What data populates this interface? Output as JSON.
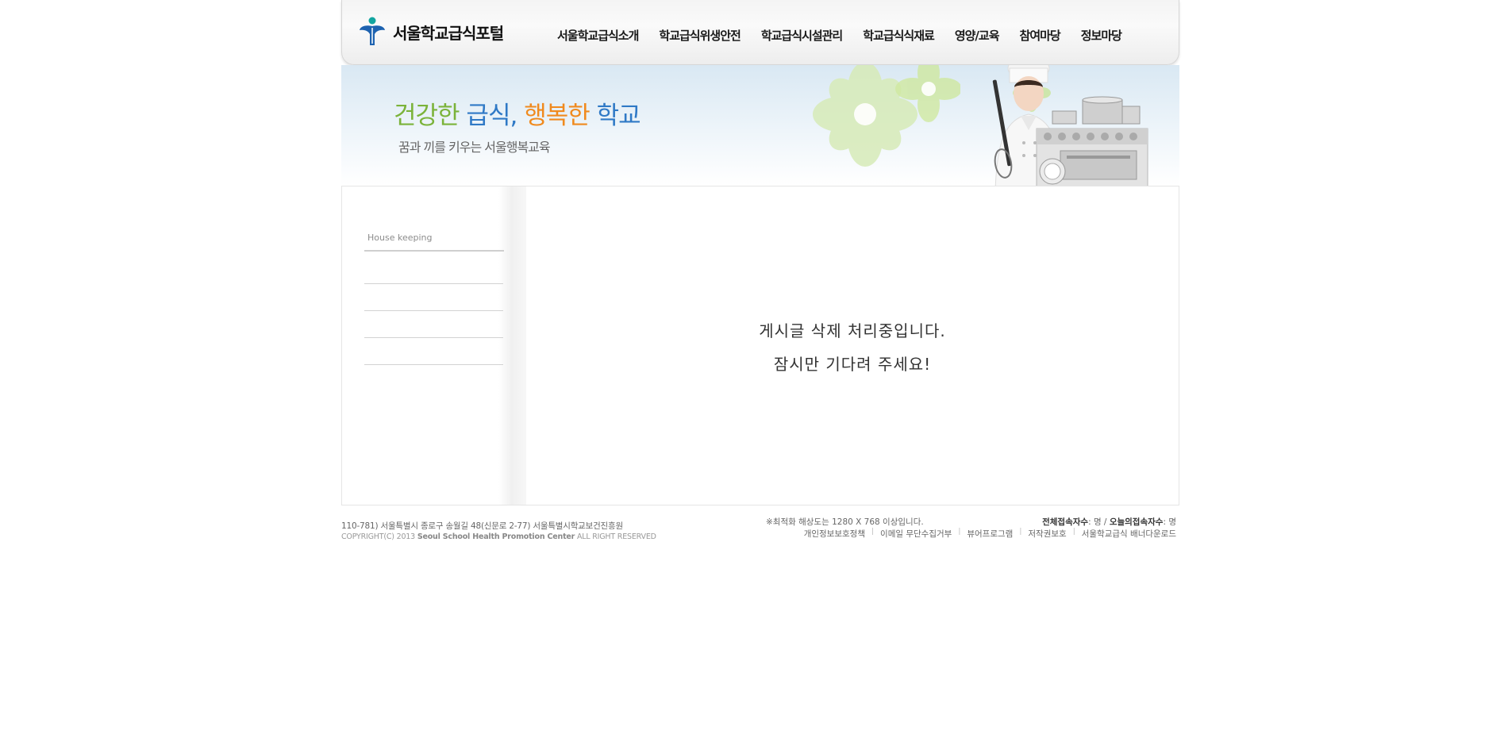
{
  "header": {
    "logo_text": "서울학교급식포털",
    "nav": [
      {
        "label": "서울학교급식소개"
      },
      {
        "label": "학교급식위생안전"
      },
      {
        "label": "학교급식시설관리"
      },
      {
        "label": "학교급식식재료"
      },
      {
        "label": "영양/교육"
      },
      {
        "label": "참여마당"
      },
      {
        "label": "정보마당"
      }
    ]
  },
  "visual": {
    "slogan_1": "건강한",
    "slogan_2": "급식,",
    "slogan_3": "행복한",
    "slogan_4": "학교",
    "sub_slogan": "꿈과 끼를 키우는 서울행복교육"
  },
  "sidebar": {
    "title": "House keeping"
  },
  "main": {
    "message_line1": "게시글 삭제 처리중입니다.",
    "message_line2": "잠시만 기다려 주세요!"
  },
  "footer": {
    "address": "110-781) 서울특별시 종로구 송월길 48(신문로 2-77) 서울특별시학교보건진흥원",
    "copyright_prefix": "COPYRIGHT(C) 2013",
    "copyright_org": "Seoul School Health Promotion Center",
    "copyright_suffix": "ALL RIGHT RESERVED",
    "resolution_note": "※최적화 해상도는 1280 X 768 이상입니다.",
    "total_label": "전체접속자수",
    "total_value": ": 명 /",
    "today_label": "오늘의접속자수",
    "today_value": ": 명",
    "links": [
      {
        "label": "개인정보보호정책"
      },
      {
        "label": "이메일 무단수집거부"
      },
      {
        "label": "뷰어프로그램"
      },
      {
        "label": "저작권보호"
      },
      {
        "label": "서울학교급식 배너다운로드"
      }
    ]
  },
  "colors": {
    "logo_blue": "#1d62b0",
    "logo_teal": "#12a5a0",
    "slogan_green": "#7bb33a",
    "slogan_blue": "#2f79c6",
    "slogan_orange": "#f08a1e"
  }
}
